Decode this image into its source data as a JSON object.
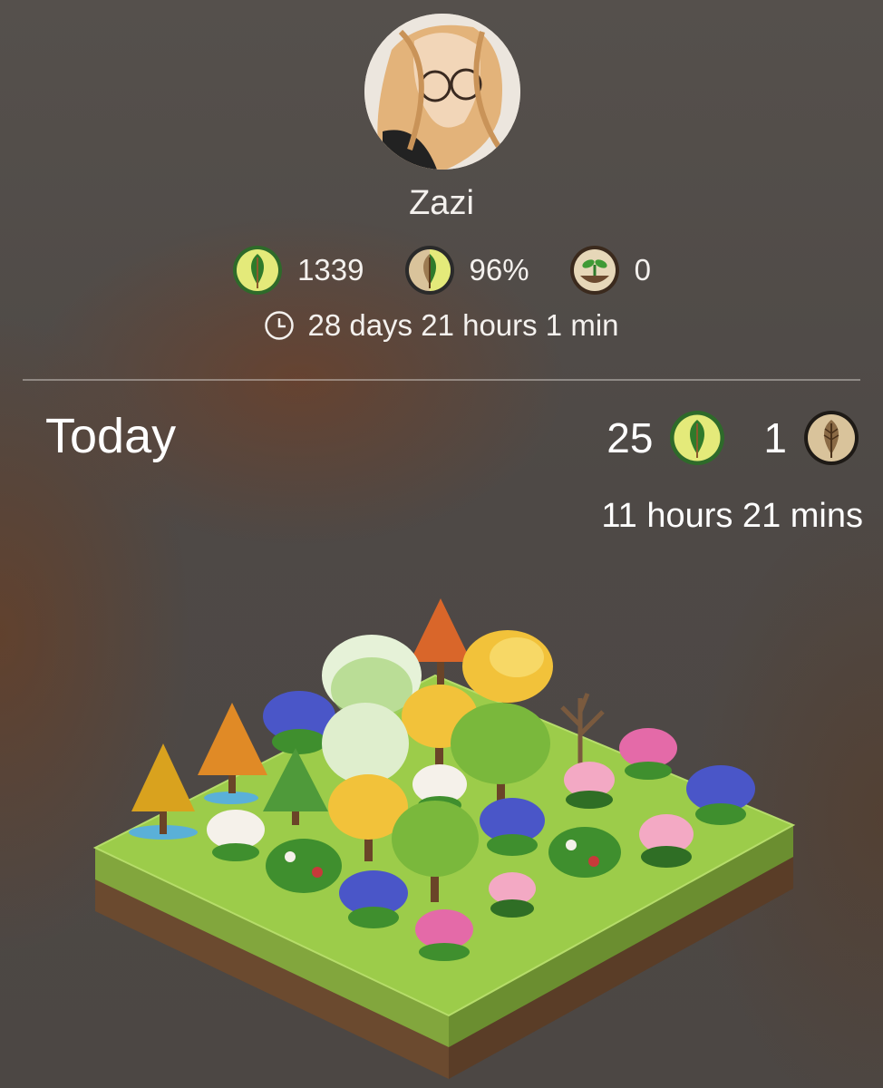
{
  "profile": {
    "username": "Zazi",
    "stats": {
      "trees": "1339",
      "success_rate": "96%",
      "plants": "0"
    },
    "total_focus_time": "28 days 21 hours 1 min"
  },
  "today": {
    "label": "Today",
    "healthy_trees": "25",
    "withered_trees": "1",
    "focus_time": "11 hours 21 mins"
  },
  "icons": {
    "tree_badge": "tree-leaf-icon",
    "rate_badge": "half-leaf-icon",
    "plant_badge": "sprout-icon",
    "clock": "clock-icon",
    "withered_badge": "withered-leaf-icon"
  },
  "colors": {
    "leaf_green": "#2f7a2b",
    "badge_yellow": "#e4ea7a",
    "withered_tan": "#d9c39b",
    "grass": "#8bc34a",
    "soil": "#6b4a2f"
  }
}
